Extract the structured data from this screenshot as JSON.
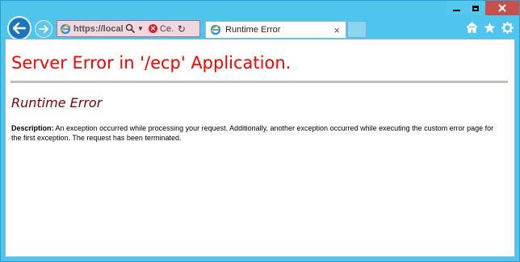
{
  "browser": {
    "address_url": "https://local...",
    "cert_label": "Ce...",
    "tab_title": "Runtime Error",
    "tab_close": "×"
  },
  "icons": {
    "back": "back-arrow-icon",
    "forward": "forward-arrow-icon",
    "home": "home-icon",
    "favorites": "star-icon",
    "settings": "gear-icon"
  },
  "page": {
    "title": "Server Error in '/ecp' Application.",
    "subtitle": "Runtime Error",
    "description_label": "Description:",
    "description_text": "An exception occurred while processing your request. Additionally, another exception occurred while executing the custom error page for the first exception. The request has been terminated."
  },
  "colors": {
    "frame": "#4fc4ec",
    "title": "#ff0000",
    "subtitle": "#800000",
    "close_button": "#c7504b"
  }
}
